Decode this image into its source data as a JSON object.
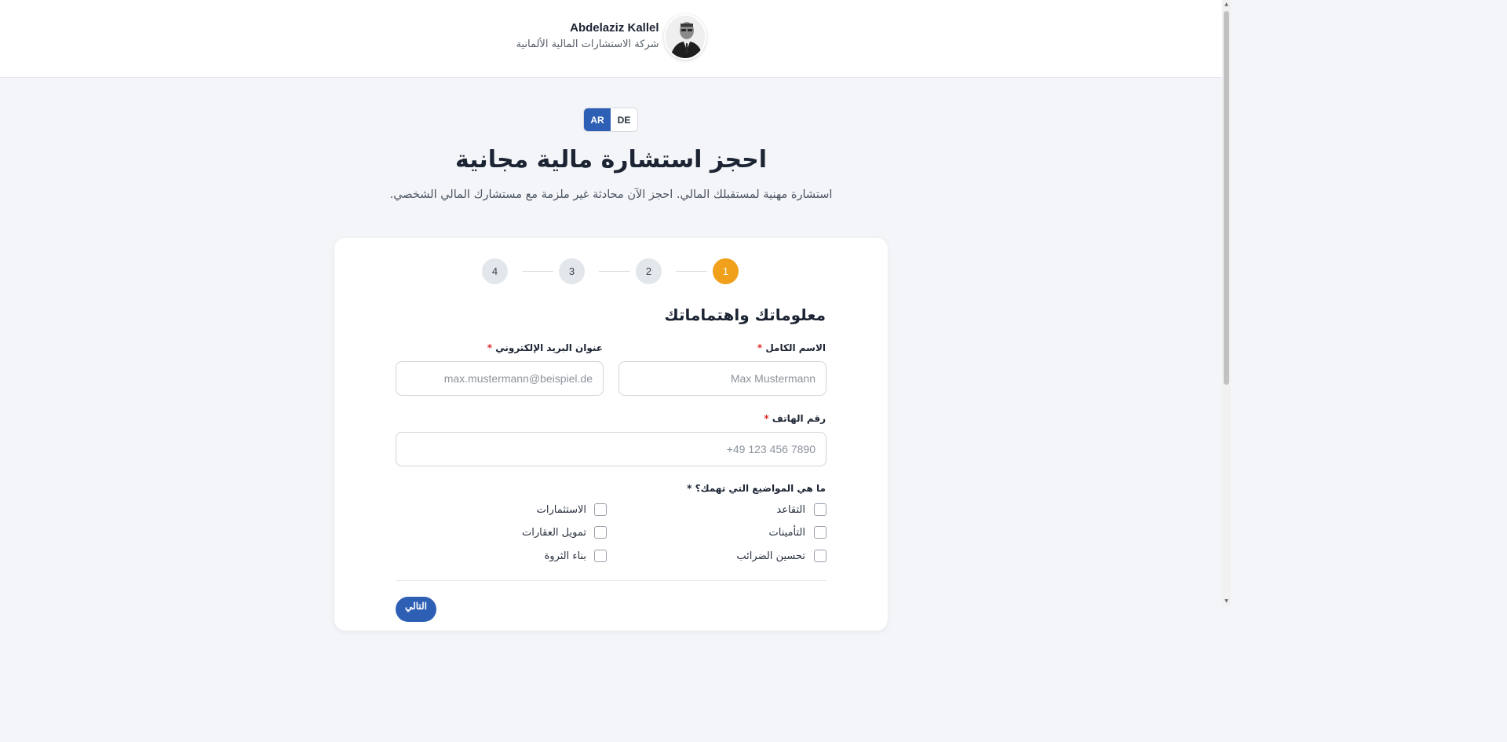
{
  "header": {
    "name": "Abdelaziz Kallel",
    "company": "شركة الاستشارات المالية الألمانية"
  },
  "language": {
    "options": [
      "AR",
      "DE"
    ],
    "selected": "AR"
  },
  "hero": {
    "title": "احجز استشارة مالية مجانية",
    "subtitle": "استشارة مهنية لمستقبلك المالي. احجز الآن محادثة غير ملزمة مع مستشارك المالي الشخصي."
  },
  "steps": {
    "items": [
      "1",
      "2",
      "3",
      "4"
    ],
    "current": 1
  },
  "form": {
    "section_title": "معلوماتك واهتماماتك",
    "full_name": {
      "label": "الاسم الكامل",
      "required_mark": "*",
      "placeholder": "Max Mustermann",
      "value": ""
    },
    "email": {
      "label": "عنوان البريد الإلكتروني",
      "required_mark": "*",
      "placeholder": "max.mustermann@beispiel.de",
      "value": ""
    },
    "phone": {
      "label": "رقم الهاتف",
      "required_mark": "*",
      "placeholder": "+49 123 456 7890",
      "value": ""
    },
    "topics": {
      "label": "ما هي المواضيع التي تهمك؟ *",
      "options": [
        {
          "label": "التقاعد",
          "checked": false
        },
        {
          "label": "الاستثمارات",
          "checked": false
        },
        {
          "label": "التأمينات",
          "checked": false
        },
        {
          "label": "تمويل العقارات",
          "checked": false
        },
        {
          "label": "تحسين الضرائب",
          "checked": false
        },
        {
          "label": "بناء الثروة",
          "checked": false
        }
      ]
    },
    "next_label": "التالي"
  },
  "colors": {
    "accent": "#2d5fb4",
    "step_active": "#f0a01a",
    "required": "#e02b2b",
    "background": "#f3f5f8"
  }
}
